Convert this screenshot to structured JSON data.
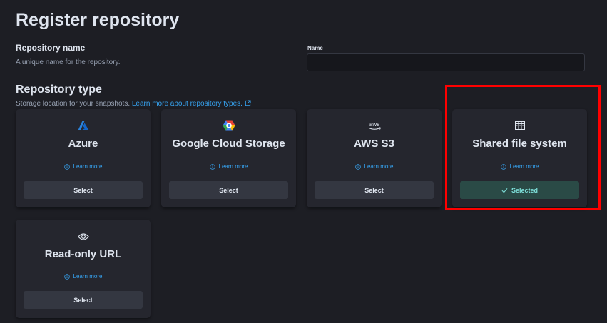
{
  "header": {
    "title": "Register repository"
  },
  "name_field": {
    "title": "Repository name",
    "description": "A unique name for the repository.",
    "label": "Name",
    "value": "",
    "placeholder": ""
  },
  "repo_type": {
    "title": "Repository type",
    "description": "Storage location for your snapshots.",
    "learn_more_link": "Learn more about repository types."
  },
  "cards": [
    {
      "title": "Azure",
      "learn_more": "Learn more",
      "button": "Select",
      "icon": "azure-icon"
    },
    {
      "title": "Google Cloud Storage",
      "learn_more": "Learn more",
      "button": "Select",
      "icon": "google-cloud-icon"
    },
    {
      "title": "AWS S3",
      "learn_more": "Learn more",
      "button": "Select",
      "icon": "aws-icon",
      "icon_text": "aws"
    },
    {
      "title": "Shared file system",
      "learn_more": "Learn more",
      "button": "Selected",
      "icon": "file-system-icon",
      "selected": true
    },
    {
      "title": "Read-only URL",
      "learn_more": "Learn more",
      "button": "Select",
      "icon": "eye-icon"
    }
  ],
  "colors": {
    "background": "#1d1e24",
    "card": "#25262e",
    "link": "#36a2ef",
    "selected_button": "#2a4a46",
    "selected_text": "#7dded8",
    "highlight": "#ff0000"
  }
}
